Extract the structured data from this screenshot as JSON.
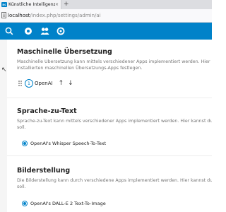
{
  "browser": {
    "tab_title": "Künstliche Intelligenz - N",
    "favicon_text": "nc",
    "close_glyph": "×",
    "new_tab_glyph": "+",
    "url_host": "localhost",
    "url_path": "/index.php/settings/admin/ai"
  },
  "header": {
    "brand_color": "#0082c9",
    "icons": [
      "search-icon",
      "photos-icon",
      "users-icon",
      "circles-icon"
    ]
  },
  "sections": {
    "translation": {
      "title": "Maschinelle Übersetzung",
      "description_line1": "Maschinelle Übersetzung kann mittels verschiedener Apps implementiert werden. Hier kannst du die",
      "description_line2": "installierten maschinellen Übersetzungs-Apps festlegen.",
      "providers": [
        {
          "order": "1",
          "label": "OpenAI"
        }
      ],
      "move_up_glyph": "↑",
      "move_down_glyph": "↓"
    },
    "speech_to_text": {
      "title": "Sprache-zu-Text",
      "description_line1": "Sprache-zu-Text kann mittels verschiedener Apps implementiert werden. Hier kannst du einstellen, w",
      "description_line2": "soll.",
      "selected_provider": "OpenAI's Whisper Speech-To-Text"
    },
    "image_generation": {
      "title": "Bilderstellung",
      "description_line1": "Die Bilderstellung kann durch verschiedene Apps implementiert werden. Hier kannst du einstellen, w",
      "description_line2": "soll.",
      "selected_provider": "OpenAI's DALL-E 2 Text-To-Image"
    }
  }
}
